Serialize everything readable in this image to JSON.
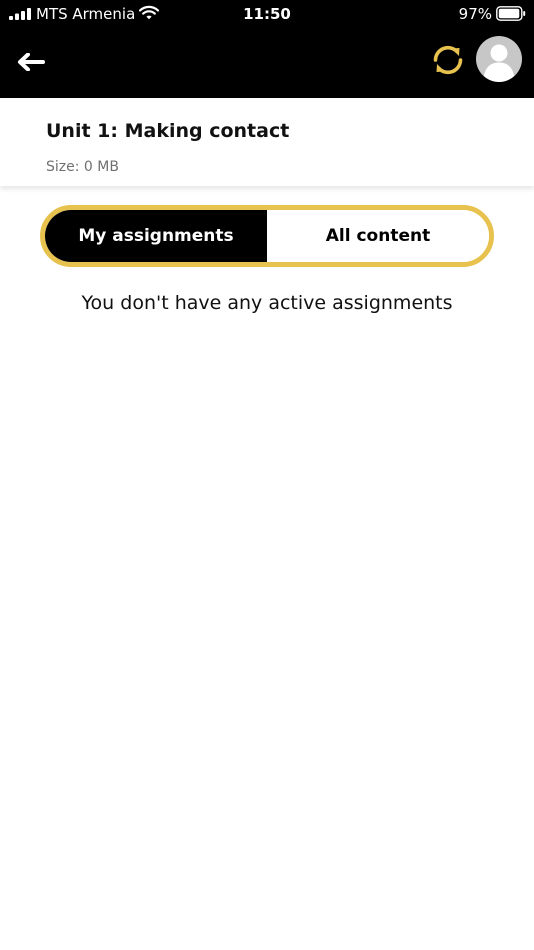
{
  "status_bar": {
    "carrier": "MTS Armenia",
    "time": "11:50",
    "battery": "97%"
  },
  "nav": {
    "back_icon": "arrow-left-icon",
    "sync_icon": "sync-icon",
    "avatar_icon": "user-avatar-icon"
  },
  "unit": {
    "title": "Unit 1: Making contact",
    "size": "Size: 0 MB"
  },
  "tabs": [
    {
      "label": "My assignments",
      "selected": true
    },
    {
      "label": "All content",
      "selected": false
    }
  ],
  "empty_state": {
    "message": "You don't have any active assignments"
  },
  "colors": {
    "accent": "#e7c24e",
    "top_bar": "#000000",
    "avatar_bg": "#c7c7c7"
  }
}
